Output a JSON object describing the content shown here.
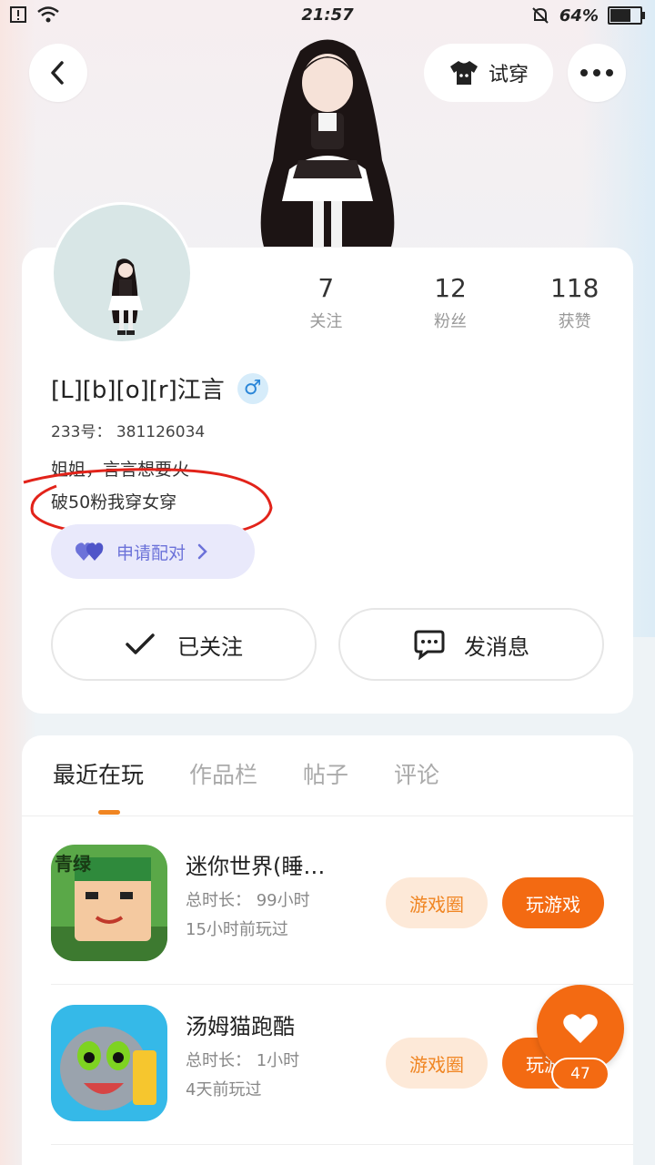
{
  "status_bar": {
    "time": "21:57",
    "battery_percent": "64%",
    "battery_level": 0.64
  },
  "header": {
    "try_on_label": "试穿"
  },
  "profile": {
    "username": "[L][b][o][r]江言",
    "gender_symbol": "♂",
    "uid": "233号： 381126034",
    "bio_line1": "姐姐，言言想要火",
    "bio_line2": "破50粉我穿女穿",
    "pair_label": "申请配对",
    "stats": [
      {
        "value": "7",
        "label": "关注"
      },
      {
        "value": "12",
        "label": "粉丝"
      },
      {
        "value": "118",
        "label": "获赞"
      }
    ],
    "follow_label": "已关注",
    "message_label": "发消息"
  },
  "tabs": [
    {
      "label": "最近在玩",
      "active": true
    },
    {
      "label": "作品栏",
      "active": false
    },
    {
      "label": "帖子",
      "active": false
    },
    {
      "label": "评论",
      "active": false
    }
  ],
  "games": [
    {
      "title": "迷你世界(睡…",
      "duration": "总时长： 99小时",
      "last_played": "15小时前玩过",
      "circle_label": "游戏圈",
      "play_label": "玩游戏",
      "icon_text": "青绿"
    },
    {
      "title": "汤姆猫跑酷",
      "duration": "总时长： 1小时",
      "last_played": "4天前玩过",
      "circle_label": "游戏圈",
      "play_label": "玩游戏"
    }
  ],
  "fab": {
    "count": "47"
  },
  "colors": {
    "accent": "#f36a12",
    "accent_light": "#fde9d8",
    "pair_bg": "#e9e9fb",
    "pair_text": "#6c72d9",
    "gender_blue": "#2a86d8"
  }
}
